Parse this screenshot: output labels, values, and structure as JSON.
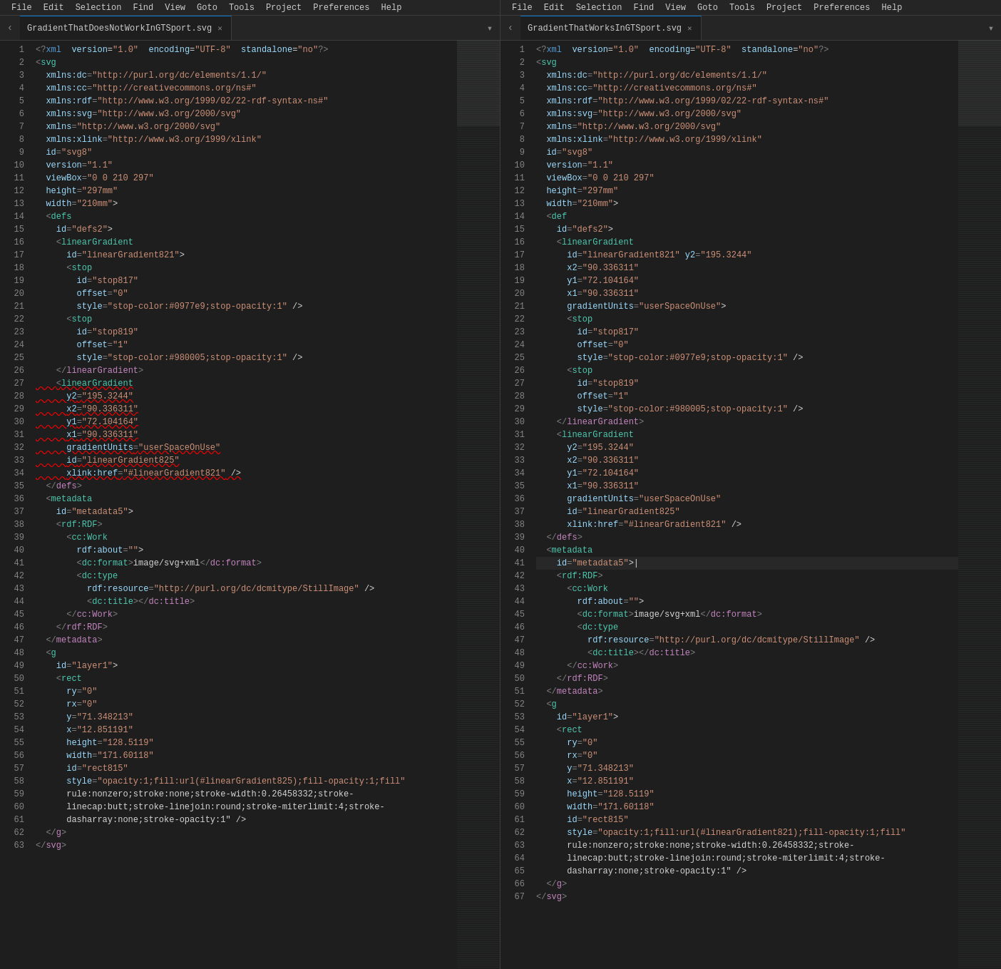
{
  "menubar": {
    "left": {
      "items": [
        "File",
        "Edit",
        "Selection",
        "Find",
        "View",
        "Goto",
        "Tools",
        "Project",
        "Preferences",
        "Help"
      ]
    },
    "right": {
      "items": [
        "File",
        "Edit",
        "Selection",
        "Find",
        "View",
        "Goto",
        "Tools",
        "Project",
        "Preferences",
        "Help"
      ]
    }
  },
  "tabs": {
    "left": {
      "filename": "GradientThatDoesNotWorkInGTSport.svg"
    },
    "right": {
      "filename": "GradientThatWorksInGTSport.svg"
    }
  },
  "left_code": [
    {
      "n": 1,
      "t": "<?xml version=\"1.0\" encoding=\"UTF-8\" standalone=\"no\"?>"
    },
    {
      "n": 2,
      "t": "<svg"
    },
    {
      "n": 3,
      "t": "  xmlns:dc=\"http://purl.org/dc/elements/1.1/\""
    },
    {
      "n": 4,
      "t": "  xmlns:cc=\"http://creativecommons.org/ns#\""
    },
    {
      "n": 5,
      "t": "  xmlns:rdf=\"http://www.w3.org/1999/02/22-rdf-syntax-ns#\""
    },
    {
      "n": 6,
      "t": "  xmlns:svg=\"http://www.w3.org/2000/svg\""
    },
    {
      "n": 7,
      "t": "  xmlns=\"http://www.w3.org/2000/svg\""
    },
    {
      "n": 8,
      "t": "  xmlns:xlink=\"http://www.w3.org/1999/xlink\""
    },
    {
      "n": 9,
      "t": "  id=\"svg8\""
    },
    {
      "n": 10,
      "t": "  version=\"1.1\""
    },
    {
      "n": 11,
      "t": "  viewBox=\"0 0 210 297\""
    },
    {
      "n": 12,
      "t": "  height=\"297mm\""
    },
    {
      "n": 13,
      "t": "  width=\"210mm\">"
    },
    {
      "n": 14,
      "t": "  <defs"
    },
    {
      "n": 15,
      "t": "    id=\"defs2\">"
    },
    {
      "n": 16,
      "t": "    <linearGradient"
    },
    {
      "n": 17,
      "t": "      id=\"linearGradient821\">"
    },
    {
      "n": 18,
      "t": "      <stop"
    },
    {
      "n": 19,
      "t": "        id=\"stop817\""
    },
    {
      "n": 20,
      "t": "        offset=\"0\""
    },
    {
      "n": 21,
      "t": "        style=\"stop-color:#0977e9;stop-opacity:1\" />"
    },
    {
      "n": 22,
      "t": "      <stop"
    },
    {
      "n": 23,
      "t": "        id=\"stop819\""
    },
    {
      "n": 24,
      "t": "        offset=\"1\""
    },
    {
      "n": 25,
      "t": "        style=\"stop-color:#980005;stop-opacity:1\" />"
    },
    {
      "n": 26,
      "t": "    </linearGradient>"
    },
    {
      "n": 27,
      "t": "    <linearGradient"
    },
    {
      "n": 28,
      "t": "      y2=\"195.3244\""
    },
    {
      "n": 29,
      "t": "      x2=\"90.336311\""
    },
    {
      "n": 30,
      "t": "      y1=\"72.104164\""
    },
    {
      "n": 31,
      "t": "      x1=\"90.336311\""
    },
    {
      "n": 32,
      "t": "      gradientUnits=\"userSpaceOnUse\""
    },
    {
      "n": 33,
      "t": "      id=\"linearGradient825\""
    },
    {
      "n": 34,
      "t": "      xlink:href=\"#linearGradient821\" />"
    },
    {
      "n": 35,
      "t": "  </defs>"
    },
    {
      "n": 36,
      "t": "  <metadata"
    },
    {
      "n": 37,
      "t": "    id=\"metadata5\">"
    },
    {
      "n": 38,
      "t": "    <rdf:RDF>"
    },
    {
      "n": 39,
      "t": "      <cc:Work"
    },
    {
      "n": 40,
      "t": "        rdf:about=\"\">"
    },
    {
      "n": 41,
      "t": "        <dc:format>image/svg+xml</dc:format>"
    },
    {
      "n": 42,
      "t": "        <dc:type"
    },
    {
      "n": 43,
      "t": "          rdf:resource=\"http://purl.org/dc/dcmitype/StillImage\" />"
    },
    {
      "n": 44,
      "t": "          <dc:title></dc:title>"
    },
    {
      "n": 45,
      "t": "      </cc:Work>"
    },
    {
      "n": 46,
      "t": "    </rdf:RDF>"
    },
    {
      "n": 47,
      "t": "  </metadata>"
    },
    {
      "n": 48,
      "t": "  <g"
    },
    {
      "n": 49,
      "t": "    id=\"layer1\">"
    },
    {
      "n": 50,
      "t": "    <rect"
    },
    {
      "n": 51,
      "t": "      ry=\"0\""
    },
    {
      "n": 52,
      "t": "      rx=\"0\""
    },
    {
      "n": 53,
      "t": "      y=\"71.348213\""
    },
    {
      "n": 54,
      "t": "      x=\"12.851191\""
    },
    {
      "n": 55,
      "t": "      height=\"128.5119\""
    },
    {
      "n": 56,
      "t": "      width=\"171.60118\""
    },
    {
      "n": 57,
      "t": "      id=\"rect815\""
    },
    {
      "n": 58,
      "t": "      style=\"opacity:1;fill:url(#linearGradient825);fill-opacity:1;fill-"
    },
    {
      "n": 59,
      "t": "      rule:nonzero;stroke:none;stroke-width:0.26458332;stroke-"
    },
    {
      "n": 60,
      "t": "      linecap:butt;stroke-linejoin:round;stroke-miterlimit:4;stroke-"
    },
    {
      "n": 61,
      "t": "      dasharray:none;stroke-opacity:1\" />"
    },
    {
      "n": 62,
      "t": "  </g>"
    },
    {
      "n": 63,
      "t": "</svg>"
    }
  ],
  "right_code": [
    {
      "n": 1,
      "t": "<?xml version=\"1.0\" encoding=\"UTF-8\" standalone=\"no\"?>"
    },
    {
      "n": 2,
      "t": "<svg"
    },
    {
      "n": 3,
      "t": "  xmlns:dc=\"http://purl.org/dc/elements/1.1/\""
    },
    {
      "n": 4,
      "t": "  xmlns:cc=\"http://creativecommons.org/ns#\""
    },
    {
      "n": 5,
      "t": "  xmlns:rdf=\"http://www.w3.org/1999/02/22-rdf-syntax-ns#\""
    },
    {
      "n": 6,
      "t": "  xmlns:svg=\"http://www.w3.org/2000/svg\""
    },
    {
      "n": 7,
      "t": "  xmlns=\"http://www.w3.org/2000/svg\""
    },
    {
      "n": 8,
      "t": "  xmlns:xlink=\"http://www.w3.org/1999/xlink\""
    },
    {
      "n": 9,
      "t": "  id=\"svg8\""
    },
    {
      "n": 10,
      "t": "  version=\"1.1\""
    },
    {
      "n": 11,
      "t": "  viewBox=\"0 0 210 297\""
    },
    {
      "n": 12,
      "t": "  height=\"297mm\""
    },
    {
      "n": 13,
      "t": "  width=\"210mm\">"
    },
    {
      "n": 14,
      "t": "  <def"
    },
    {
      "n": 15,
      "t": "    id=\"defs2\">"
    },
    {
      "n": 16,
      "t": "    <linearGradient"
    },
    {
      "n": 17,
      "t": "      id=\"linearGradient821\" y2=\"195.3244\""
    },
    {
      "n": 18,
      "t": "      x2=\"90.336311\""
    },
    {
      "n": 19,
      "t": "      y1=\"72.104164\""
    },
    {
      "n": 20,
      "t": "      x1=\"90.336311\""
    },
    {
      "n": 21,
      "t": "      gradientUnits=\"userSpaceOnUse\">"
    },
    {
      "n": 22,
      "t": "      <stop"
    },
    {
      "n": 23,
      "t": "        id=\"stop817\""
    },
    {
      "n": 24,
      "t": "        offset=\"0\""
    },
    {
      "n": 25,
      "t": "        style=\"stop-color:#0977e9;stop-opacity:1\" />"
    },
    {
      "n": 26,
      "t": "      <stop"
    },
    {
      "n": 27,
      "t": "        id=\"stop819\""
    },
    {
      "n": 28,
      "t": "        offset=\"1\""
    },
    {
      "n": 29,
      "t": "        style=\"stop-color:#980005;stop-opacity:1\" />"
    },
    {
      "n": 30,
      "t": "    </linearGradient>"
    },
    {
      "n": 31,
      "t": "    <linearGradient"
    },
    {
      "n": 32,
      "t": "      y2=\"195.3244\""
    },
    {
      "n": 33,
      "t": "      x2=\"90.336311\""
    },
    {
      "n": 34,
      "t": "      y1=\"72.104164\""
    },
    {
      "n": 35,
      "t": "      x1=\"90.336311\""
    },
    {
      "n": 36,
      "t": "      gradientUnits=\"userSpaceOnUse\""
    },
    {
      "n": 37,
      "t": "      id=\"linearGradient825\""
    },
    {
      "n": 38,
      "t": "      xlink:href=\"#linearGradient821\" />"
    },
    {
      "n": 39,
      "t": "  </defs>"
    },
    {
      "n": 40,
      "t": "  <metadata"
    },
    {
      "n": 41,
      "t": "    id=\"metadata5\">|"
    },
    {
      "n": 42,
      "t": "    <rdf:RDF>"
    },
    {
      "n": 43,
      "t": "      <cc:Work"
    },
    {
      "n": 44,
      "t": "        rdf:about=\"\">"
    },
    {
      "n": 45,
      "t": "        <dc:format>image/svg+xml</dc:format>"
    },
    {
      "n": 46,
      "t": "        <dc:type"
    },
    {
      "n": 47,
      "t": "          rdf:resource=\"http://purl.org/dc/dcmitype/StillImage\" />"
    },
    {
      "n": 48,
      "t": "          <dc:title></dc:title>"
    },
    {
      "n": 49,
      "t": "      </cc:Work>"
    },
    {
      "n": 50,
      "t": "    </rdf:RDF>"
    },
    {
      "n": 51,
      "t": "  </metadata>"
    },
    {
      "n": 52,
      "t": "  <g"
    },
    {
      "n": 53,
      "t": "    id=\"layer1\">"
    },
    {
      "n": 54,
      "t": "    <rect"
    },
    {
      "n": 55,
      "t": "      ry=\"0\""
    },
    {
      "n": 56,
      "t": "      rx=\"0\""
    },
    {
      "n": 57,
      "t": "      y=\"71.348213\""
    },
    {
      "n": 58,
      "t": "      x=\"12.851191\""
    },
    {
      "n": 59,
      "t": "      height=\"128.5119\""
    },
    {
      "n": 60,
      "t": "      width=\"171.60118\""
    },
    {
      "n": 61,
      "t": "      id=\"rect815\""
    },
    {
      "n": 62,
      "t": "      style=\"opacity:1;fill:url(#linearGradient821);fill-opacity:1;fill-"
    },
    {
      "n": 63,
      "t": "      rule:nonzero;stroke:none;stroke-width:0.26458332;stroke-"
    },
    {
      "n": 64,
      "t": "      linecap:butt;stroke-linejoin:round;stroke-miterlimit:4;stroke-"
    },
    {
      "n": 65,
      "t": "      dasharray:none;stroke-opacity:1\" />"
    },
    {
      "n": 66,
      "t": "  </g>"
    },
    {
      "n": 67,
      "t": "</svg>"
    }
  ]
}
